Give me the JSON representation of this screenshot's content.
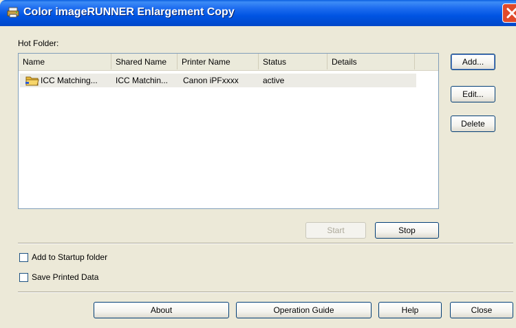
{
  "window": {
    "title": "Color imageRUNNER Enlargement Copy",
    "app_icon": "printer-app-icon",
    "close_icon": "close-x-icon"
  },
  "hot_folder": {
    "label": "Hot Folder:",
    "columns": [
      "Name",
      "Shared Name",
      "Printer Name",
      "Status",
      "Details"
    ],
    "rows": [
      {
        "icon": "folder-icon",
        "name": "ICC Matching...",
        "shared_name": "ICC Matchin...",
        "printer_name": "Canon iPFxxxx",
        "status": "active",
        "details": ""
      }
    ]
  },
  "side_buttons": {
    "add": "Add...",
    "edit": "Edit...",
    "delete": "Delete"
  },
  "run_buttons": {
    "start": "Start",
    "stop": "Stop"
  },
  "options": {
    "startup_label": "Add to Startup folder",
    "startup_checked": false,
    "save_printed_label": "Save Printed Data",
    "save_printed_checked": false
  },
  "footer_buttons": {
    "about": "About",
    "operation_guide": "Operation Guide",
    "help": "Help",
    "close": "Close"
  },
  "colors": {
    "titlebar": "#0054e3",
    "dialog_bg": "#ece9d8",
    "close_button": "#e04a2b",
    "button_border": "#003c74"
  }
}
